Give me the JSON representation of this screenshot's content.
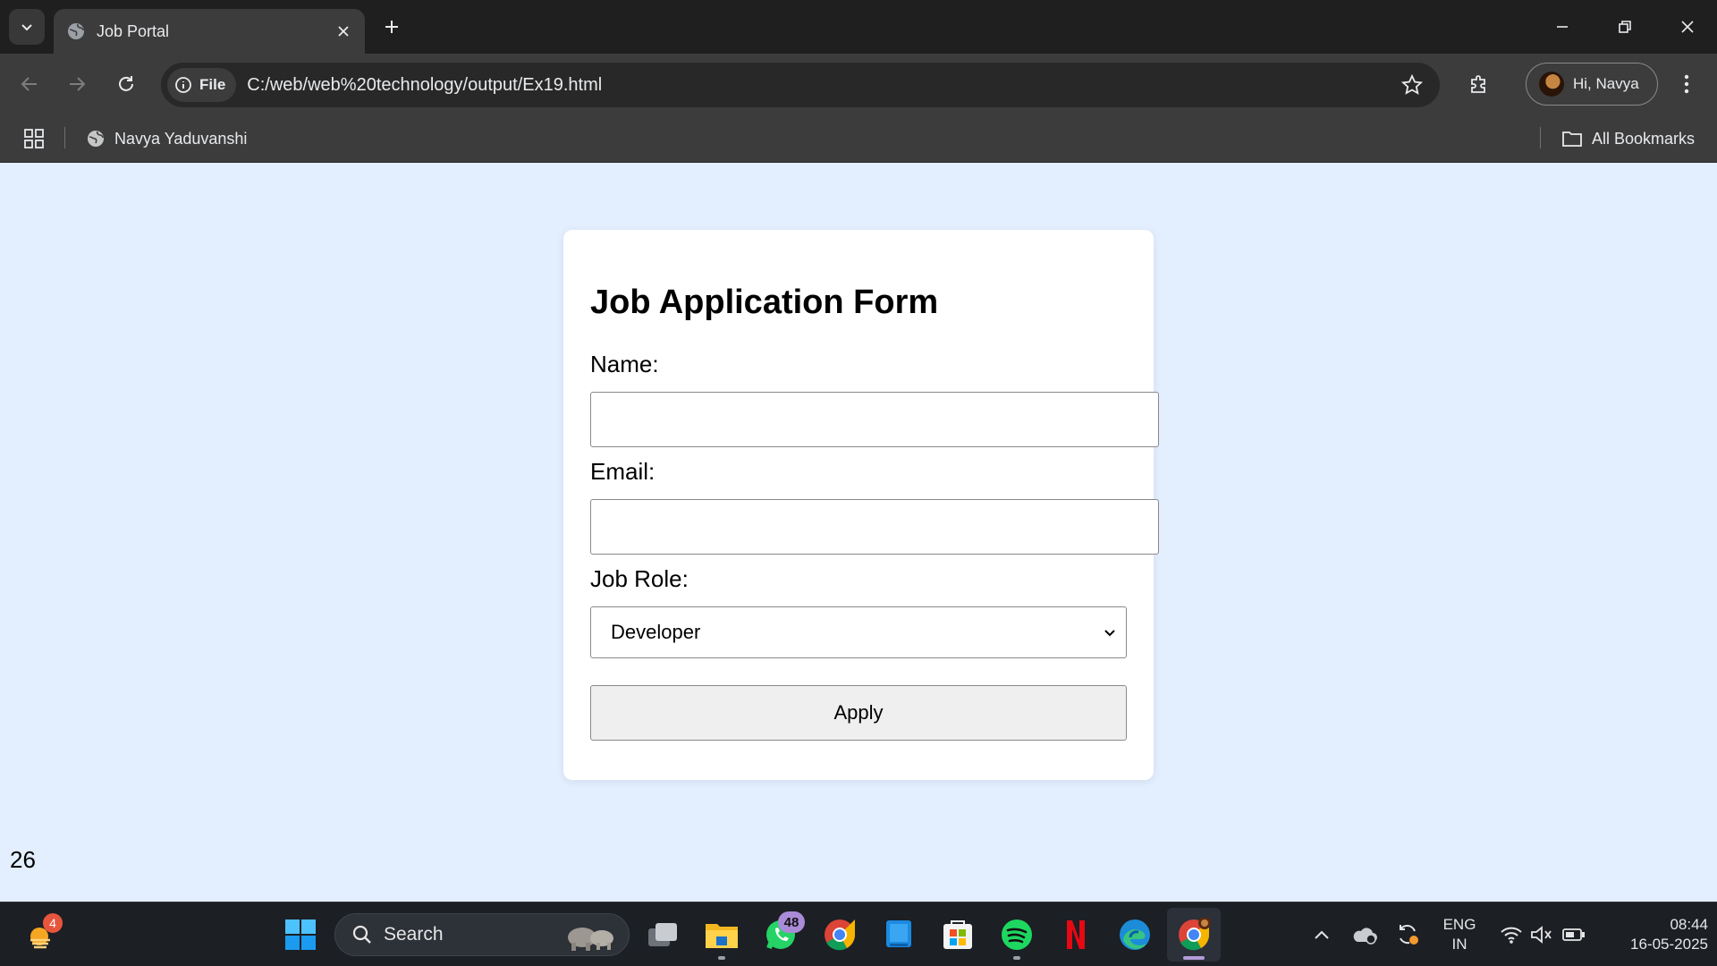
{
  "browser": {
    "tab_title": "Job Portal",
    "chip_label": "File",
    "url": "C:/web/web%20technology/output/Ex19.html",
    "profile_label": "Hi, Navya",
    "bookmarks": [
      {
        "label": "Navya Yaduvanshi"
      }
    ],
    "all_bookmarks_label": "All Bookmarks"
  },
  "form": {
    "title": "Job Application Form",
    "name_label": "Name:",
    "name_value": "",
    "email_label": "Email:",
    "email_value": "",
    "role_label": "Job Role:",
    "role_selected": "Developer",
    "apply_label": "Apply"
  },
  "stray_text": "26",
  "taskbar": {
    "weather_badge": "4",
    "search_label": "Search",
    "whatsapp_badge": "48",
    "lang_line1": "ENG",
    "lang_line2": "IN",
    "time": "08:44",
    "date": "16-05-2025"
  },
  "colors": {
    "page_background": "#e3efff",
    "card_background": "#ffffff",
    "chrome_dark": "#1f1f1f",
    "chrome_toolbar": "#3c3c3c"
  }
}
